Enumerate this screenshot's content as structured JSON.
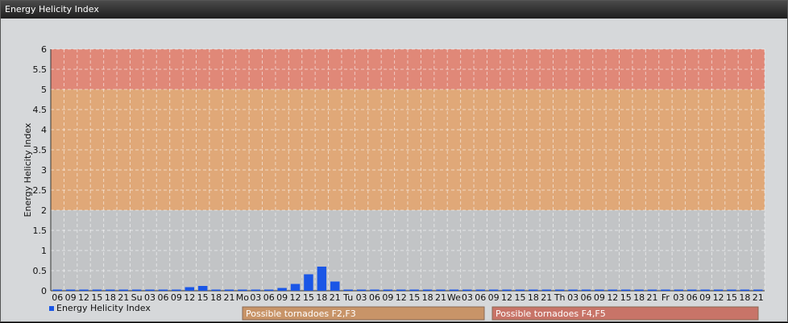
{
  "window": {
    "title": "Energy Helicity Index"
  },
  "chart_data": {
    "type": "bar",
    "ylabel": "Energy Helicity Index",
    "ylim": [
      0,
      6
    ],
    "yticks": [
      "0",
      "0.5",
      "1",
      "1.5",
      "2",
      "2.5",
      "3",
      "3.5",
      "4",
      "4.5",
      "5",
      "5.5",
      "6"
    ],
    "categories": [
      "06",
      "09",
      "12",
      "15",
      "18",
      "21",
      "Su",
      "03",
      "06",
      "09",
      "12",
      "15",
      "18",
      "21",
      "Mo",
      "03",
      "06",
      "09",
      "12",
      "15",
      "18",
      "21",
      "Tu",
      "03",
      "06",
      "09",
      "12",
      "15",
      "18",
      "21",
      "We",
      "03",
      "06",
      "09",
      "12",
      "15",
      "18",
      "21",
      "Th",
      "03",
      "06",
      "09",
      "12",
      "15",
      "18",
      "21",
      "Fr",
      "03",
      "06",
      "09",
      "12",
      "15",
      "18",
      "21"
    ],
    "series": [
      {
        "name": "Energy Helicity Index",
        "color": "#1a56e6",
        "values": [
          0,
          0,
          0,
          0,
          0,
          0,
          0,
          0,
          0,
          0,
          0.09,
          0.12,
          0,
          0,
          0,
          0,
          0,
          0.07,
          0.17,
          0.41,
          0.6,
          0.23,
          0,
          0,
          0,
          0,
          0,
          0,
          0,
          0,
          0,
          0,
          0,
          0,
          0,
          0,
          0,
          0,
          0,
          0,
          0,
          0,
          0,
          0,
          0,
          0,
          0,
          0,
          0,
          0,
          0,
          0,
          0,
          0
        ]
      }
    ],
    "bands": [
      {
        "from": 0,
        "to": 2,
        "color": "#c2c4c6"
      },
      {
        "from": 2,
        "to": 5,
        "color": "#e0a878",
        "label": "Possible tornadoes F2,F3"
      },
      {
        "from": 5,
        "to": 6,
        "color": "#e08878",
        "label": "Possible tornadoes F4,F5"
      }
    ],
    "grid": true,
    "legend": "bottom-left"
  }
}
